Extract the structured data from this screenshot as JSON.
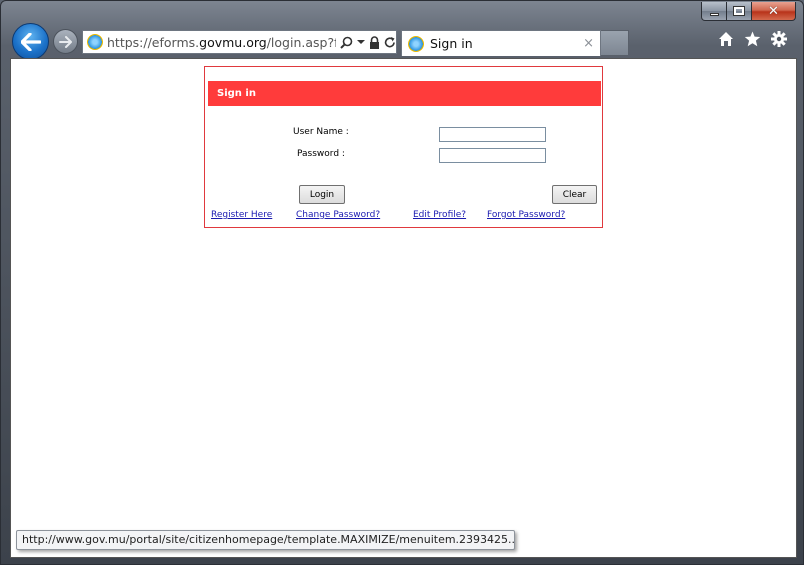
{
  "browser": {
    "address": {
      "url_prefix": "https://eforms.",
      "url_domain": "govmu.org",
      "url_path": "/login.asp?forn"
    },
    "tab": {
      "title": "Sign in",
      "close_glyph": "×"
    },
    "status_url": "http://www.gov.mu/portal/site/citizenhomepage/template.MAXIMIZE/menuitem.2393425..."
  },
  "form": {
    "header": "Sign in",
    "username_label": "User Name :",
    "password_label": "Password :",
    "login_label": "Login",
    "clear_label": "Clear",
    "links": {
      "register": "Register Here",
      "change_password": "Change Password?",
      "edit_profile": "Edit Profile?",
      "forgot_password": "Forgot Password?"
    }
  },
  "icons": {
    "back": "arrow-left-icon",
    "forward": "arrow-right-icon",
    "search": "search-icon",
    "lock": "lock-icon",
    "refresh": "refresh-icon",
    "home": "home-icon",
    "favorites": "star-icon",
    "tools": "gear-icon"
  },
  "colors": {
    "header_red": "#ff3b3b",
    "box_border": "#e0393e",
    "link_blue": "#1a1ab0"
  }
}
